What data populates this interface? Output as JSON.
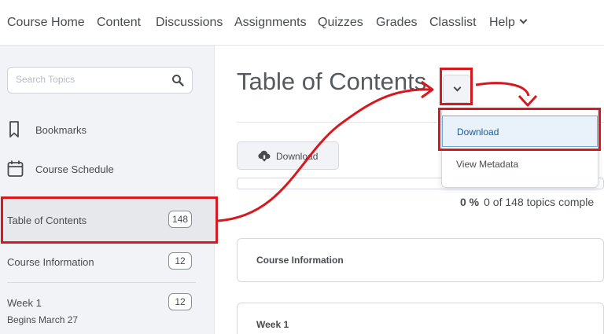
{
  "nav": {
    "items": [
      "Course Home",
      "Content",
      "Discussions",
      "Assignments",
      "Quizzes",
      "Grades",
      "Classlist",
      "Help"
    ]
  },
  "sidebar": {
    "search_placeholder": "Search Topics",
    "bookmarks": "Bookmarks",
    "course_schedule": "Course Schedule",
    "toc": [
      {
        "label": "Table of Contents",
        "count": "148"
      },
      {
        "label": "Course Information",
        "count": "12"
      },
      {
        "label": "Week 1",
        "sub": "Begins March 27",
        "count": "12"
      }
    ]
  },
  "main": {
    "title": "Table of Contents",
    "download_label": "Download",
    "progress": {
      "percent_label": "0 %",
      "text": "0 of 148 topics comple",
      "fraction": 0
    },
    "menu": [
      "Download",
      "View Metadata"
    ],
    "cards": [
      "Course Information",
      "Week 1"
    ]
  },
  "colors": {
    "annotation": "#d7191f",
    "accent": "#006fbf"
  }
}
